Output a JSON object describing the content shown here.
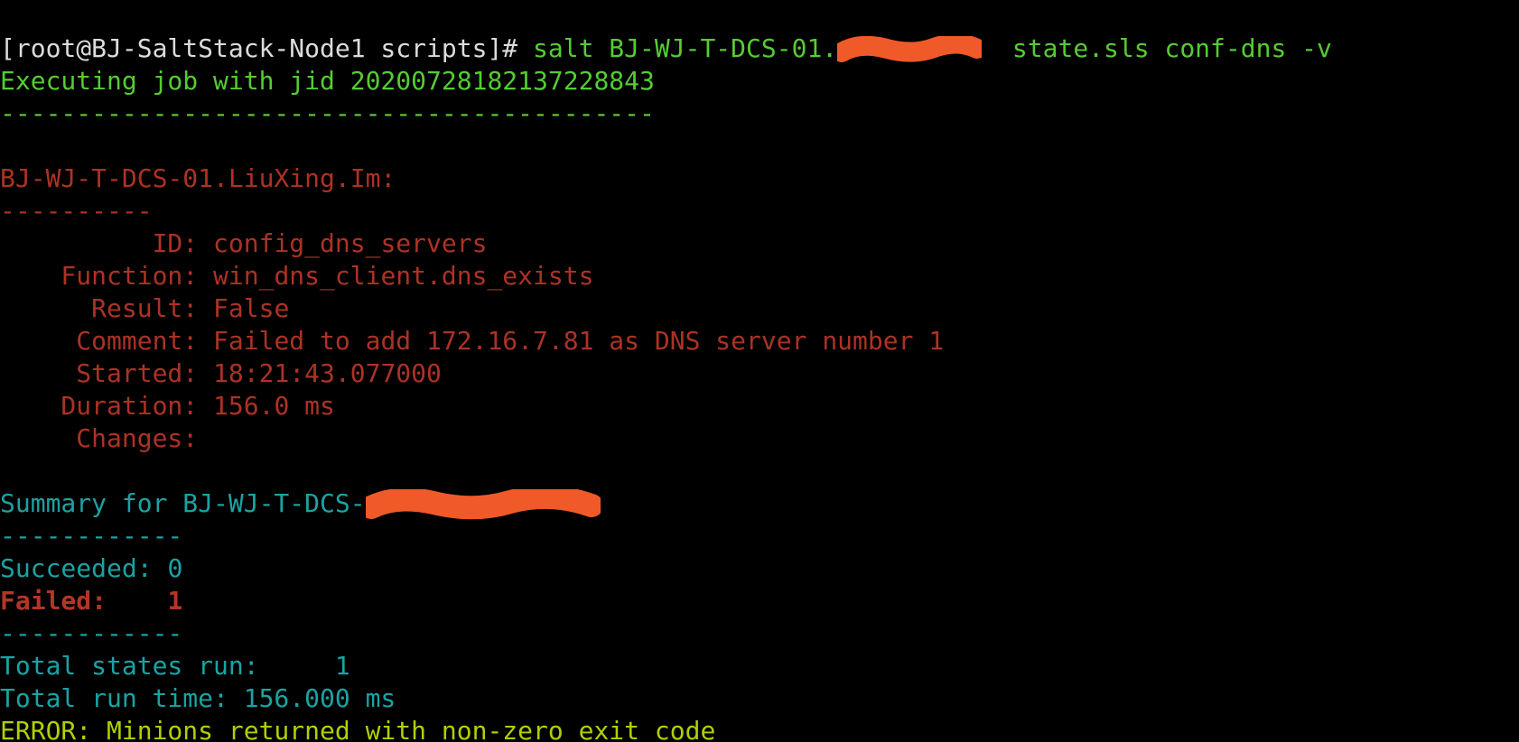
{
  "prompt": {
    "shell": "[root@BJ-SaltStack-Node1 scripts]#",
    "cmd1": "salt BJ-WJ-T-DCS-01.",
    "cmd2": "  state.sls conf-dns -v"
  },
  "job_line": "Executing job with jid 20200728182137228843",
  "rule_long": "-------------------------------------------",
  "minion_header": "BJ-WJ-T-DCS-01.LiuXing.Im:",
  "rule_short": "----------",
  "state": {
    "id_label": "          ID: ",
    "id": "config_dns_servers",
    "func_label": "    Function: ",
    "func": "win_dns_client.dns_exists",
    "result_label": "      Result: ",
    "result": "False",
    "comment_label": "     Comment: ",
    "comment": "Failed to add 172.16.7.81 as DNS server number 1",
    "started_label": "     Started: ",
    "started": "18:21:43.077000",
    "duration_label": "    Duration: ",
    "duration": "156.0 ms",
    "changes_label": "     Changes:"
  },
  "summary_prefix": "Summary for BJ-WJ-T-DCS-",
  "rule_sum": "------------",
  "succeeded_label": "Succeeded: ",
  "succeeded_value": "0",
  "failed_label": "Failed:    ",
  "failed_value": "1",
  "total_states_label": "Total states run:     ",
  "total_states_value": "1",
  "total_time_label": "Total run time: ",
  "total_time_value": "156.000 ms",
  "error_line": "ERROR: Minions returned with non-zero exit code"
}
